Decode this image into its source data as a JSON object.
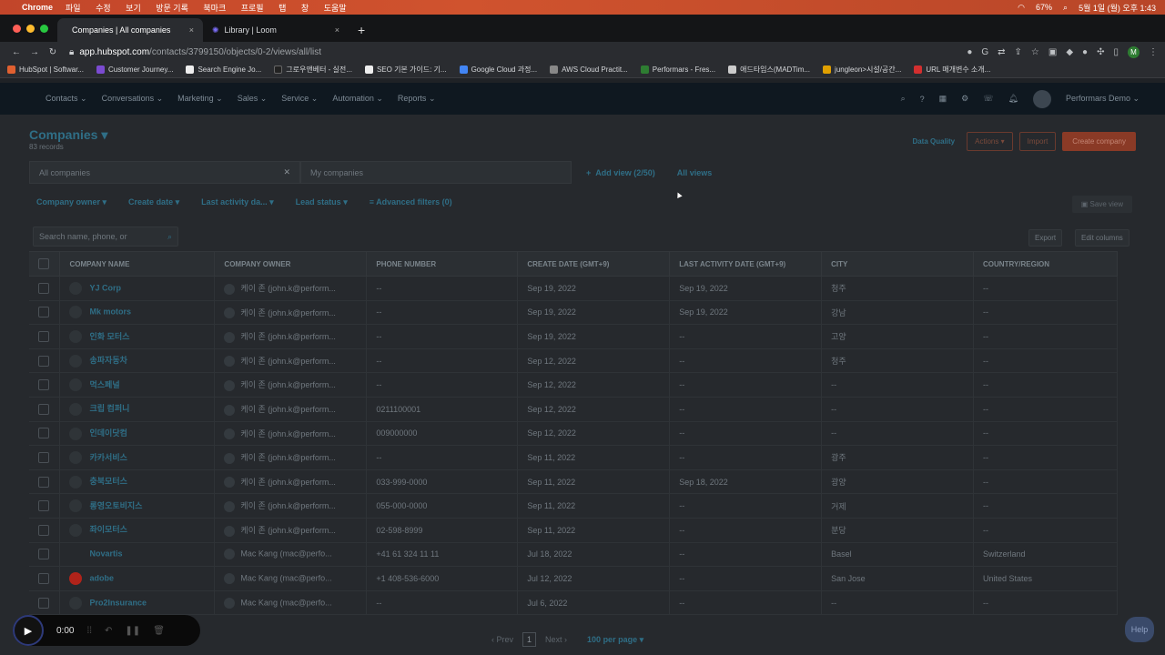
{
  "mac_menu": {
    "app": "Chrome",
    "items": [
      "파일",
      "수정",
      "보기",
      "방문 기록",
      "북마크",
      "프로필",
      "탭",
      "창",
      "도움말"
    ],
    "battery": "67%",
    "clock": "5월 1일 (월) 오후 1:43"
  },
  "browser": {
    "tabs": [
      {
        "label": "Companies | All companies",
        "active": true
      },
      {
        "label": "Library | Loom",
        "active": false
      }
    ],
    "url_host": "app.hubspot.com",
    "url_path": "/contacts/3799150/objects/0-2/views/all/list",
    "profile_initial": "M"
  },
  "bookmarks": [
    {
      "label": "HubSpot | Softwar...",
      "color": "#e06030"
    },
    {
      "label": "Customer Journey...",
      "color": "#7b4bd1"
    },
    {
      "label": "Search Engine Jo...",
      "color": "#eeeeee"
    },
    {
      "label": "그로우앤베터 - 실전...",
      "color": "#222222"
    },
    {
      "label": "SEO 기본 가이드: 기...",
      "color": "#eeeeee"
    },
    {
      "label": "Google Cloud 과정...",
      "color": "#4285f4"
    },
    {
      "label": "AWS Cloud Practit...",
      "color": "#888888"
    },
    {
      "label": "Performars - Fres...",
      "color": "#2e7d32"
    },
    {
      "label": "애드타임스(MADTim...",
      "color": "#cccccc"
    },
    {
      "label": "jungleon>시설/공간...",
      "color": "#e0a000"
    },
    {
      "label": "URL 매개변수 소개...",
      "color": "#d32f2f"
    }
  ],
  "hubspot_nav": {
    "items": [
      "Contacts",
      "Conversations",
      "Marketing",
      "Sales",
      "Service",
      "Automation",
      "Reports"
    ],
    "account": "Performars Demo"
  },
  "page": {
    "title": "Companies",
    "record_count": "83 records",
    "data_quality": "Data Quality",
    "actions": "Actions",
    "import": "Import",
    "create": "Create company"
  },
  "views": {
    "tabs": [
      "All companies",
      "My companies"
    ],
    "add_view": "Add view (2/50)",
    "all_views": "All views"
  },
  "filters": [
    "Company owner",
    "Create date",
    "Last activity da...",
    "Lead status",
    "Advanced filters (0)"
  ],
  "save_view": "Save view",
  "search_placeholder": "Search name, phone, or",
  "export": "Export",
  "edit_columns": "Edit columns",
  "columns": [
    "COMPANY NAME",
    "COMPANY OWNER",
    "PHONE NUMBER",
    "CREATE DATE (GMT+9)",
    "LAST ACTIVITY DATE (GMT+9)",
    "CITY",
    "COUNTRY/REGION"
  ],
  "rows": [
    {
      "name": "YJ Corp",
      "owner": "케이 존 (john.k@perform...",
      "phone": "--",
      "create": "Sep 19, 2022",
      "activity": "Sep 19, 2022",
      "city": "청주",
      "country": "--"
    },
    {
      "name": "Mk motors",
      "owner": "케이 존 (john.k@perform...",
      "phone": "--",
      "create": "Sep 19, 2022",
      "activity": "Sep 19, 2022",
      "city": "강남",
      "country": "--"
    },
    {
      "name": "인화 모터스",
      "owner": "케이 존 (john.k@perform...",
      "phone": "--",
      "create": "Sep 19, 2022",
      "activity": "--",
      "city": "고양",
      "country": "--"
    },
    {
      "name": "송파자동차",
      "owner": "케이 존 (john.k@perform...",
      "phone": "--",
      "create": "Sep 12, 2022",
      "activity": "--",
      "city": "청주",
      "country": "--"
    },
    {
      "name": "먹스페널",
      "owner": "케이 존 (john.k@perform...",
      "phone": "--",
      "create": "Sep 12, 2022",
      "activity": "--",
      "city": "--",
      "country": "--"
    },
    {
      "name": "크립 컴퍼니",
      "owner": "케이 존 (john.k@perform...",
      "phone": "0211100001",
      "create": "Sep 12, 2022",
      "activity": "--",
      "city": "--",
      "country": "--"
    },
    {
      "name": "인데이닷컴",
      "owner": "케이 존 (john.k@perform...",
      "phone": "009000000",
      "create": "Sep 12, 2022",
      "activity": "--",
      "city": "--",
      "country": "--"
    },
    {
      "name": "카카서비스",
      "owner": "케이 존 (john.k@perform...",
      "phone": "--",
      "create": "Sep 11, 2022",
      "activity": "--",
      "city": "광주",
      "country": "--"
    },
    {
      "name": "충북모터스",
      "owner": "케이 존 (john.k@perform...",
      "phone": "033-999-0000",
      "create": "Sep 11, 2022",
      "activity": "Sep 18, 2022",
      "city": "광양",
      "country": "--"
    },
    {
      "name": "롱영오토비지스",
      "owner": "케이 존 (john.k@perform...",
      "phone": "055-000-0000",
      "create": "Sep 11, 2022",
      "activity": "--",
      "city": "거제",
      "country": "--"
    },
    {
      "name": "좌이모터스",
      "owner": "케이 존 (john.k@perform...",
      "phone": "02-598-8999",
      "create": "Sep 11, 2022",
      "activity": "--",
      "city": "분당",
      "country": "--"
    },
    {
      "name": "Novartis",
      "owner": "Mac Kang (mac@perfo...",
      "phone": "+41 61 324 11 11",
      "create": "Jul 18, 2022",
      "activity": "--",
      "city": "Basel",
      "country": "Switzerland"
    },
    {
      "name": "adobe",
      "owner": "Mac Kang (mac@perfo...",
      "phone": "+1 408-536-6000",
      "create": "Jul 12, 2022",
      "activity": "--",
      "city": "San Jose",
      "country": "United States"
    },
    {
      "name": "Pro2Insurance",
      "owner": "Mac Kang (mac@perfo...",
      "phone": "--",
      "create": "Jul 6, 2022",
      "activity": "--",
      "city": "--",
      "country": "--"
    }
  ],
  "pagination": {
    "prev": "Prev",
    "current": "1",
    "next": "Next",
    "per_page": "100 per page"
  },
  "recorder": {
    "time": "0:00"
  },
  "help": "Help"
}
